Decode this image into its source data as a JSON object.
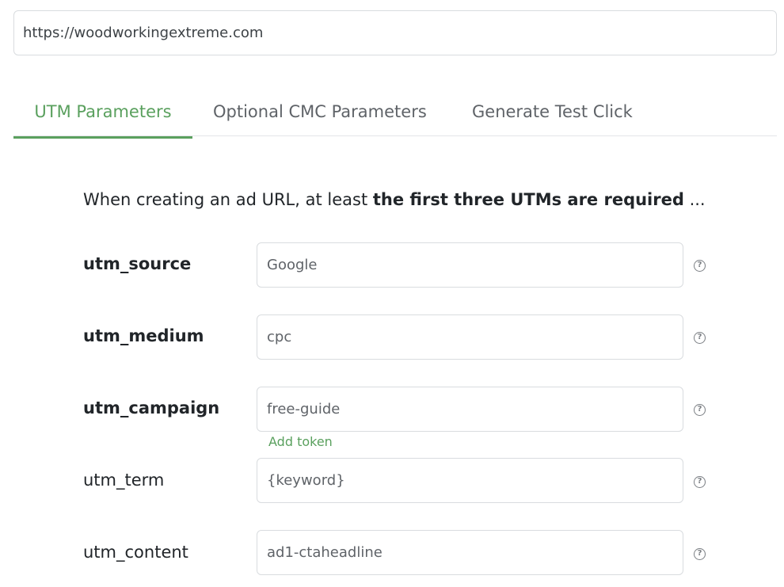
{
  "url_field": {
    "value": "https://woodworkingextreme.com"
  },
  "tabs": [
    {
      "label": "UTM Parameters",
      "active": true
    },
    {
      "label": "Optional CMC Parameters",
      "active": false
    },
    {
      "label": "Generate Test Click",
      "active": false
    }
  ],
  "intro": {
    "prefix": "When creating an ad URL, at least ",
    "bold": "the first three UTMs are required",
    "suffix": " ..."
  },
  "params": [
    {
      "label": "utm_source",
      "value": "Google",
      "required": true
    },
    {
      "label": "utm_medium",
      "value": "cpc",
      "required": true
    },
    {
      "label": "utm_campaign",
      "value": "free-guide",
      "required": true
    },
    {
      "label": "utm_term",
      "value": "{keyword}",
      "required": false
    },
    {
      "label": "utm_content",
      "value": "ad1-ctaheadline",
      "required": false
    }
  ],
  "add_token_label": "Add token",
  "help_glyph": "?",
  "colors": {
    "accent": "#5aa05e",
    "border": "#d9dcdf",
    "text": "#212529"
  },
  "icons": {
    "help": "question-circle-icon"
  }
}
